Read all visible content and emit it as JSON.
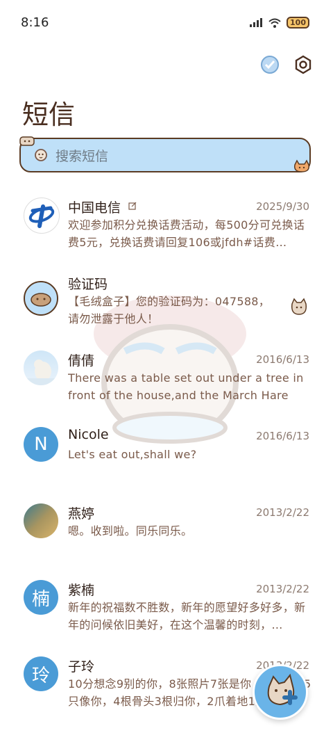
{
  "status_bar": {
    "time": "8:16",
    "battery": "100"
  },
  "page": {
    "title": "短信"
  },
  "search": {
    "placeholder": "搜索短信"
  },
  "conversations": [
    {
      "name": "中国电信",
      "date": "2025/9/30",
      "message": "欢迎参加积分兑换话费活动，每500分可兑换话费5元，兑换话费请回复106或jfdh#话费…",
      "avatar": "telecom-logo"
    },
    {
      "name": "验证码",
      "date": "",
      "message": "【毛绒盒子】您的验证码为：047588，请勿泄露于他人！",
      "avatar": "verify-icon"
    },
    {
      "name": "倩倩",
      "date": "2016/6/13",
      "message": "There was a table set out under a tree in front of the house,and the March Hare an…",
      "avatar": "polar-bear-photo"
    },
    {
      "name": "Nicole",
      "date": "2016/6/13",
      "message": "Let's eat out,shall we?",
      "avatar_letter": "N"
    },
    {
      "name": "燕婷",
      "date": "2013/2/22",
      "message": "嗯。收到啦。同乐同乐。",
      "avatar": "landscape-photo"
    },
    {
      "name": "紫楠",
      "date": "2013/2/22",
      "message": "新年的祝福数不胜数，新年的愿望好多好多，新年的问候依旧美好，在这个温馨的时刻，…",
      "avatar_letter": "楠"
    },
    {
      "name": "子玲",
      "date": "2013/2/22",
      "message": "10分想念9别的你，8张照片7张是你，6只小狗5只像你，4根骨头3根归你，2爪着地1定…",
      "avatar_letter": "玲"
    }
  ],
  "colors": {
    "accent": "#4a9bd6",
    "search_bg": "#bfe0f8",
    "outline": "#5a3a22"
  }
}
